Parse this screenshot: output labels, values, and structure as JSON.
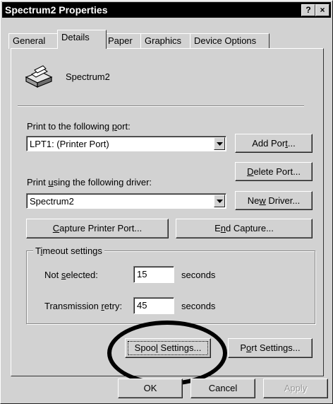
{
  "window": {
    "title": "Spectrum2 Properties",
    "help_button": "?",
    "close_button": "×"
  },
  "tabs": [
    {
      "label": "General",
      "active": false
    },
    {
      "label": "Details",
      "active": true
    },
    {
      "label": "Paper",
      "active": false
    },
    {
      "label": "Graphics",
      "active": false
    },
    {
      "label": "Device Options",
      "active": false
    }
  ],
  "printer": {
    "name": "Spectrum2",
    "icon": "printer-icon"
  },
  "port": {
    "label_pre": "Print to the following ",
    "label_key": "p",
    "label_post": "ort:",
    "selected": "LPT1:  (Printer Port)",
    "add_port_pre": "Add Por",
    "add_port_key": "t",
    "add_port_post": "...",
    "delete_port_key": "D",
    "delete_port_post": "elete Port..."
  },
  "driver": {
    "label_pre": "Print ",
    "label_key": "u",
    "label_post": "sing the following driver:",
    "selected": "Spectrum2",
    "new_driver_pre": "Ne",
    "new_driver_key": "w",
    "new_driver_post": " Driver..."
  },
  "capture": {
    "capture_key": "C",
    "capture_post": "apture Printer Port...",
    "end_pre": "E",
    "end_key": "n",
    "end_post": "d Capture..."
  },
  "timeout": {
    "title_pre": "T",
    "title_key": "i",
    "title_post": "meout settings",
    "not_selected_pre": "Not ",
    "not_selected_key": "s",
    "not_selected_post": "elected:",
    "not_selected_value": "15",
    "retry_pre": "Transmission ",
    "retry_key": "r",
    "retry_post": "etry:",
    "retry_value": "45",
    "unit": "seconds"
  },
  "spool": {
    "spool_pre": "Spoo",
    "spool_key": "l",
    "spool_post": " Settings...",
    "port_pre": "P",
    "port_key": "o",
    "port_post": "rt Settings..."
  },
  "footer": {
    "ok": "OK",
    "cancel": "Cancel",
    "apply": "Apply"
  }
}
